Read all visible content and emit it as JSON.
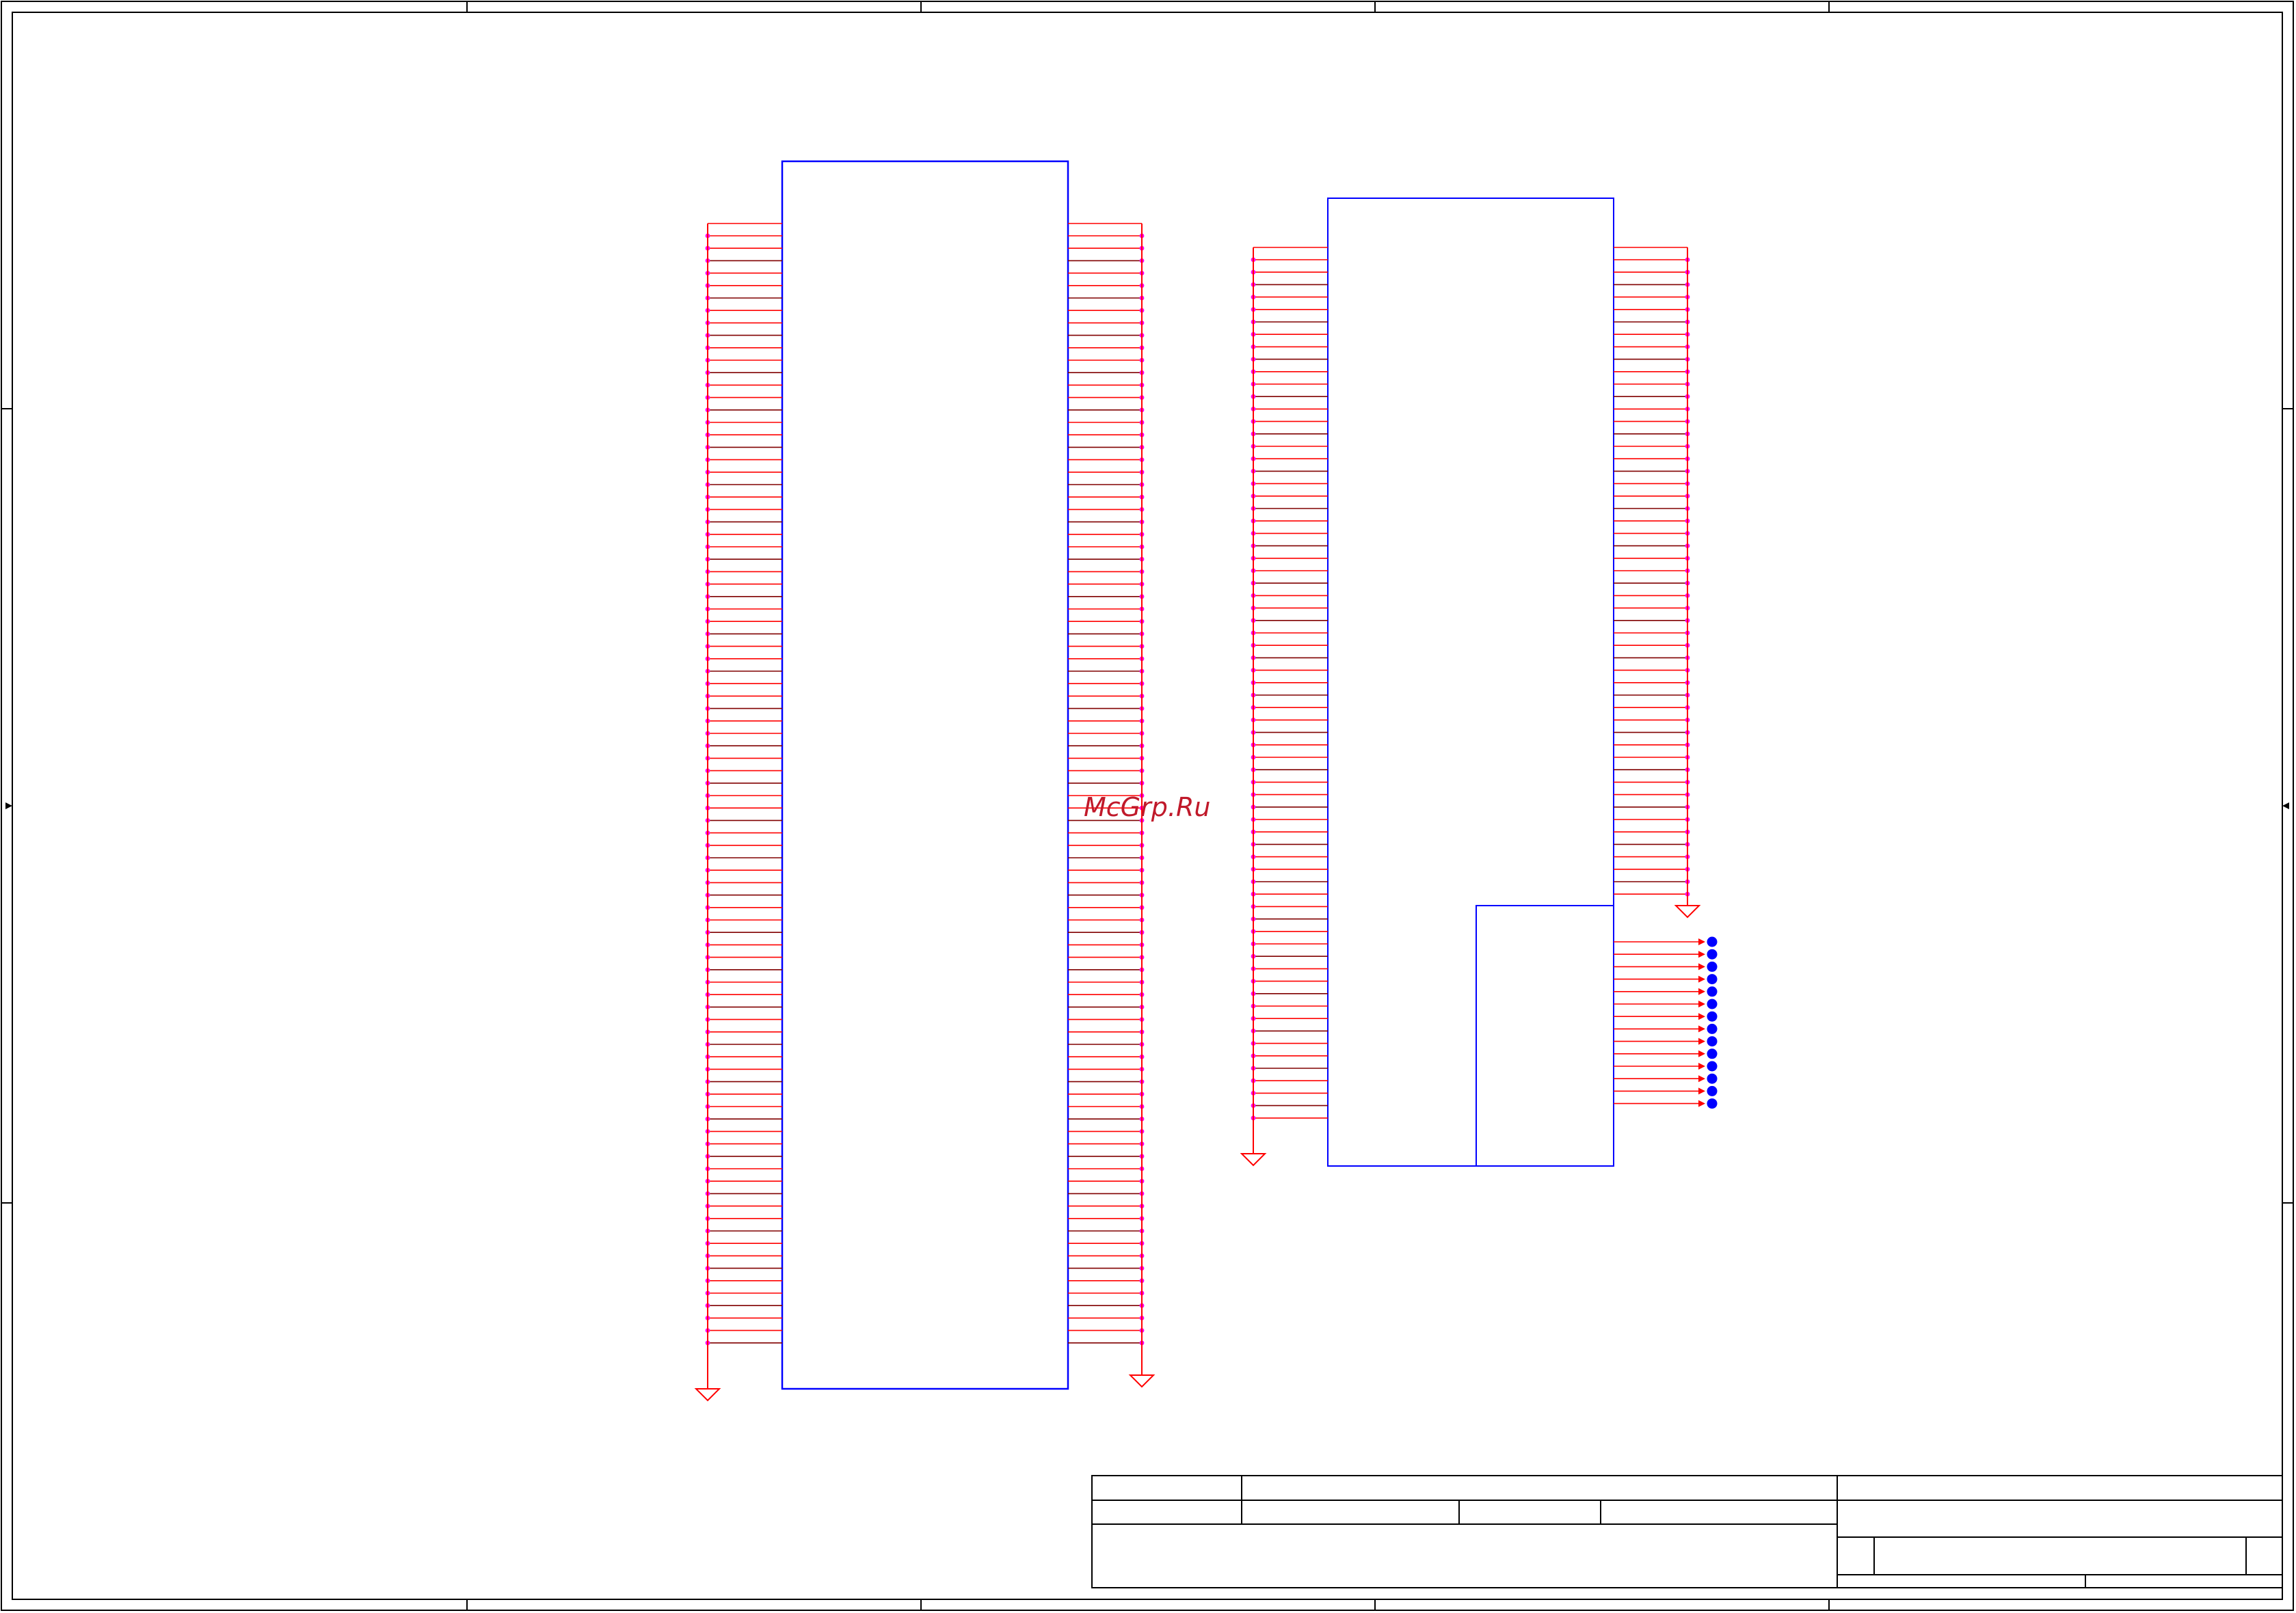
{
  "watermark": "McGrp.Ru",
  "colors": {
    "frame": "#000000",
    "component_body": "#0000ff",
    "wire": "#ff0000",
    "wire_dark": "#800000",
    "junction": "#ff00ff",
    "port": "#0000ff",
    "ground": "#ff0000",
    "watermark": "#c0192a"
  },
  "components": [
    {
      "id": "connector-1",
      "left_pins": 90,
      "right_pins": 90
    },
    {
      "id": "connector-2",
      "left_pins": 70,
      "right_pins": 52,
      "sub_unit_pins": 14
    }
  ],
  "ground_symbol_count": 5,
  "title_block": {
    "fields": []
  }
}
